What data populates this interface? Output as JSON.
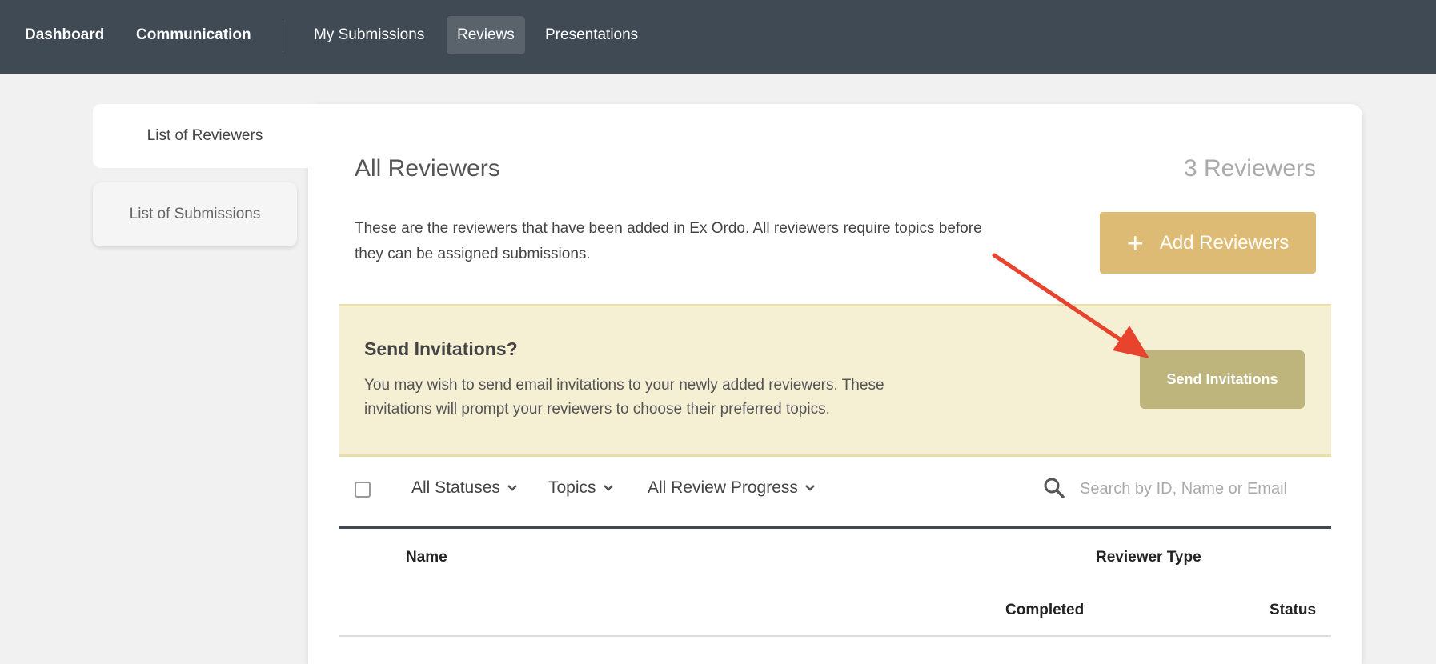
{
  "nav": {
    "items": [
      {
        "label": "Dashboard"
      },
      {
        "label": "Communication"
      },
      {
        "label": "My Submissions"
      },
      {
        "label": "Reviews",
        "active": true
      },
      {
        "label": "Presentations"
      }
    ]
  },
  "sidebar": {
    "tabs": [
      {
        "label": "List of Reviewers",
        "active": true
      },
      {
        "label": "List of Submissions"
      }
    ]
  },
  "main": {
    "title": "All Reviewers",
    "count": "3 Reviewers",
    "description": "These are the reviewers that have been added in Ex Ordo. All reviewers require topics before they can be assigned submissions.",
    "add_button": {
      "label": "Add Reviewers",
      "icon": "plus-icon"
    }
  },
  "invite": {
    "title": "Send Invitations?",
    "description": "You may wish to send email invitations to your newly added reviewers. These invitations will prompt your reviewers to choose their preferred topics.",
    "button_label": "Send Invitations"
  },
  "filters": {
    "statuses": "All Statuses",
    "topics": "Topics",
    "review_progress": "All Review Progress",
    "search_placeholder": "Search by ID, Name or Email"
  },
  "table": {
    "headers": {
      "name": "Name",
      "reviewer_type": "Reviewer Type",
      "completed": "Completed",
      "status": "Status"
    }
  },
  "colors": {
    "nav_bg": "#404a54",
    "add_button": "#ddbb75",
    "invite_bg": "#f5efd3",
    "send_button": "#bdb57c",
    "annotation_arrow": "#e8432d"
  }
}
